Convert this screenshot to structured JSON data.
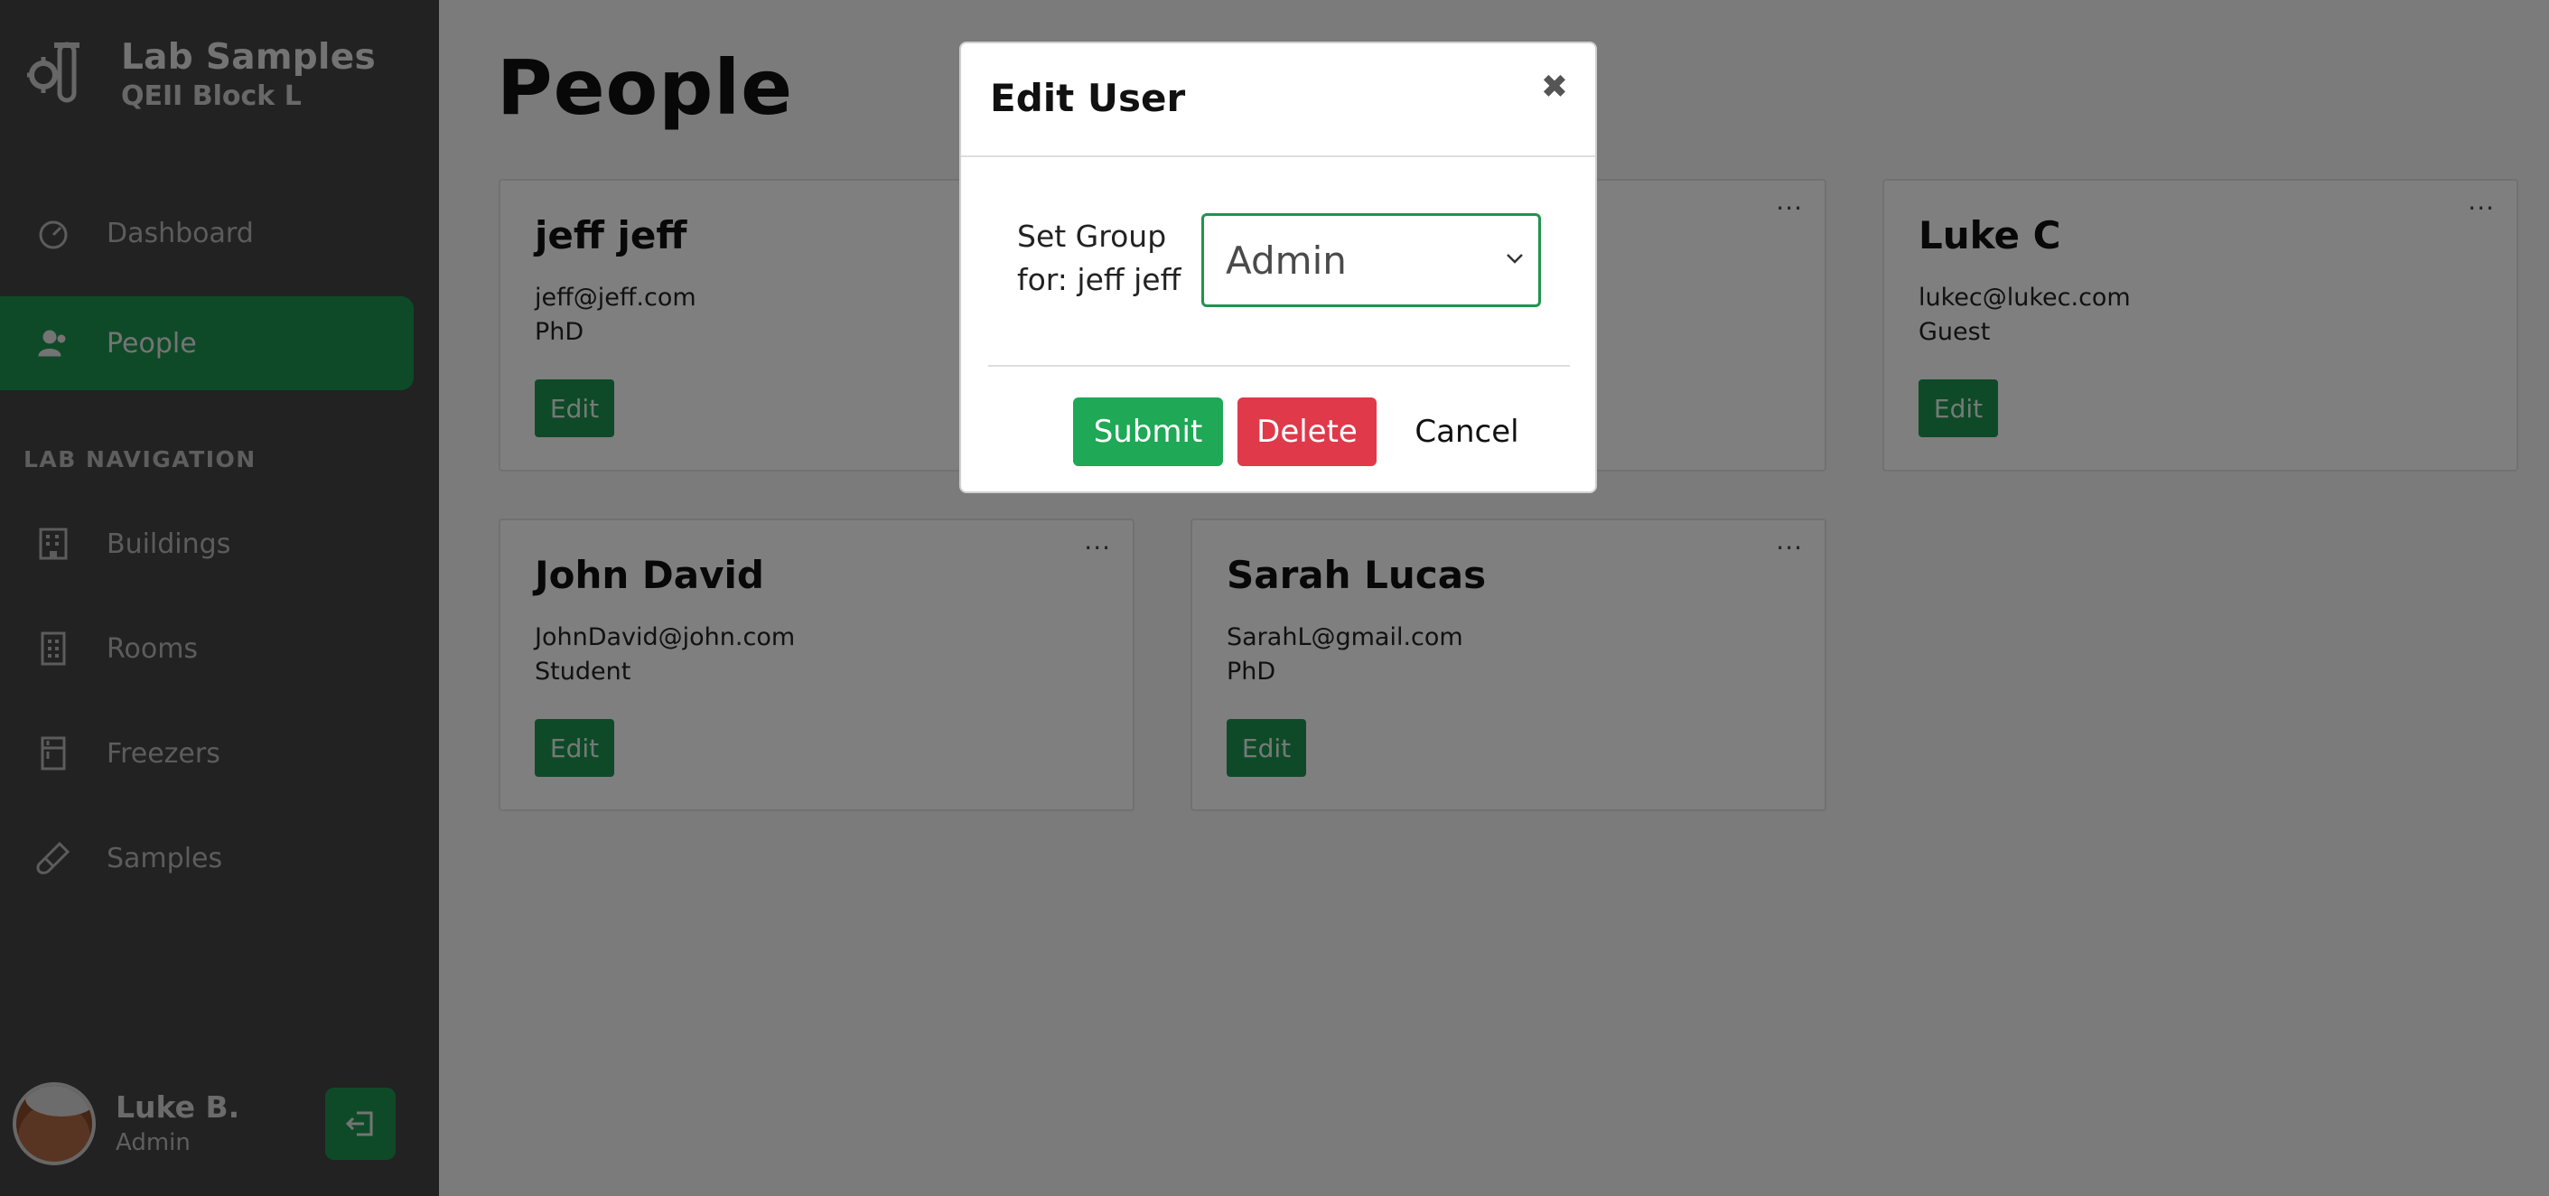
{
  "sidebar": {
    "brand_title": "Lab Samples",
    "brand_sub": "QEII Block L",
    "nav_top": [
      {
        "label": "Dashboard",
        "icon": "gauge-icon"
      },
      {
        "label": "People",
        "icon": "person-icon",
        "active": true
      }
    ],
    "section_label": "LAB NAVIGATION",
    "nav_lab": [
      {
        "label": "Buildings",
        "icon": "building-icon"
      },
      {
        "label": "Rooms",
        "icon": "room-icon"
      },
      {
        "label": "Freezers",
        "icon": "freezer-icon"
      },
      {
        "label": "Samples",
        "icon": "test-tube-icon"
      }
    ],
    "user": {
      "name": "Luke B.",
      "role": "Admin"
    },
    "logout_icon": "logout-icon"
  },
  "main": {
    "title": "People",
    "more_label": "···",
    "cards": [
      {
        "name": "jeff jeff",
        "email": "jeff@jeff.com",
        "role": "PhD",
        "edit_label": "Edit"
      },
      {
        "name": "",
        "email": "",
        "role": "",
        "edit_label": ""
      },
      {
        "name": "Luke C",
        "email": "lukec@lukec.com",
        "role": "Guest",
        "edit_label": "Edit"
      },
      {
        "name": "John David",
        "email": "JohnDavid@john.com",
        "role": "Student",
        "edit_label": "Edit"
      },
      {
        "name": "Sarah Lucas",
        "email": "SarahL@gmail.com",
        "role": "PhD",
        "edit_label": "Edit"
      }
    ]
  },
  "modal": {
    "title": "Edit User",
    "close_glyph": "✖",
    "label": "Set Group for: jeff jeff",
    "selected_group": "Admin",
    "submit_label": "Submit",
    "delete_label": "Delete",
    "cancel_label": "Cancel"
  },
  "colors": {
    "accent": "#1f9450",
    "submit": "#1fa855",
    "delete": "#e0394a",
    "sidebar": "#454545"
  }
}
